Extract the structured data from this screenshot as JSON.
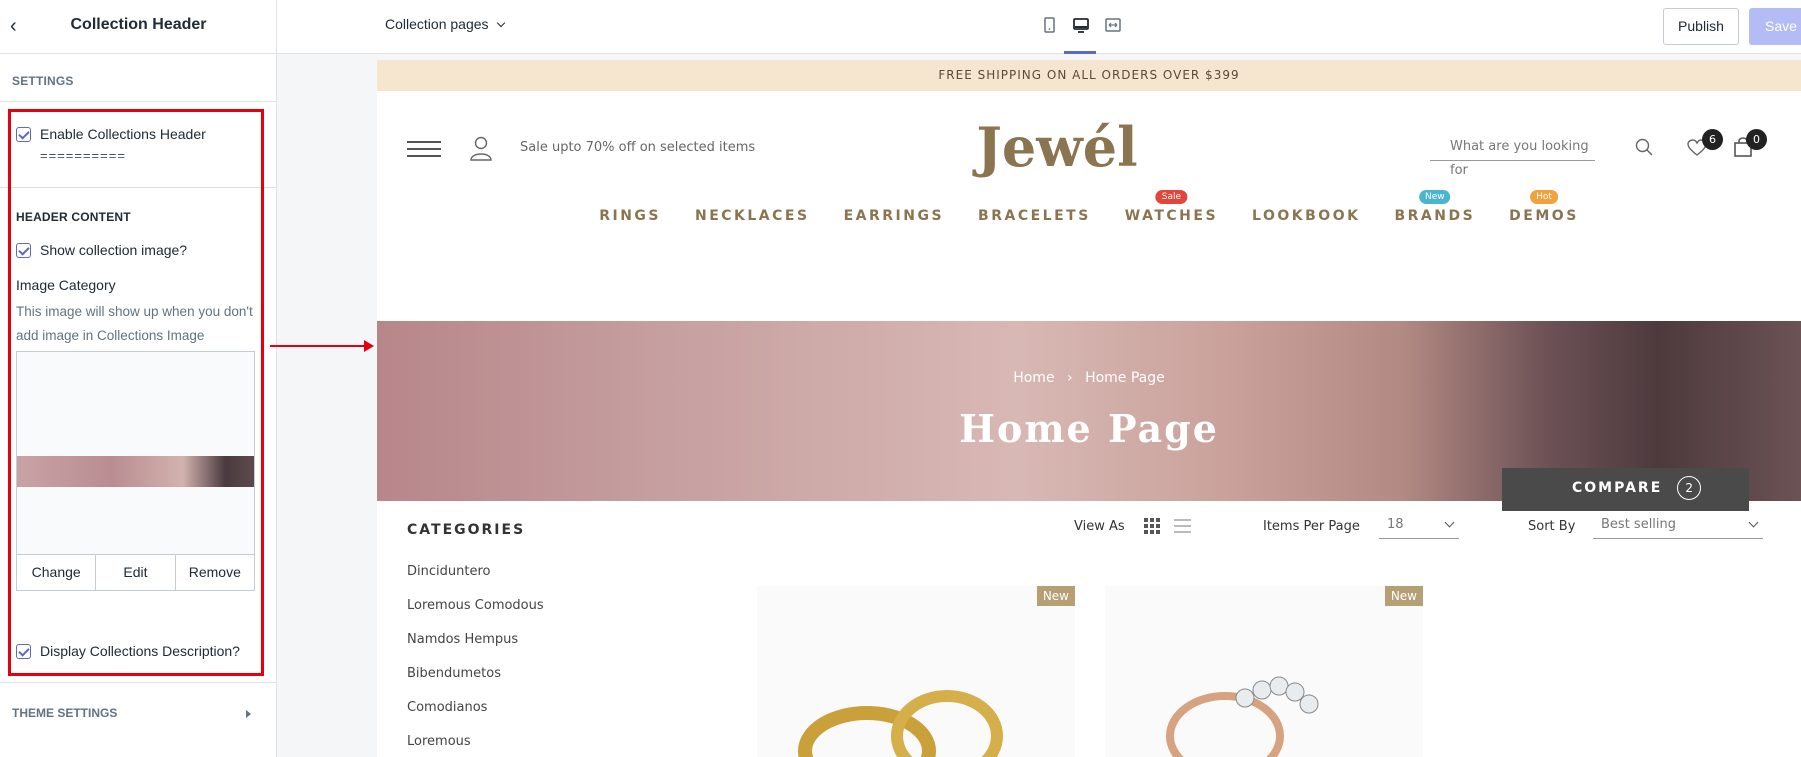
{
  "sidebar": {
    "title": "Collection Header",
    "settings_label": "SETTINGS",
    "enable_header_label": "Enable Collections Header",
    "divider_text": "==========",
    "header_content_label": "HEADER CONTENT",
    "show_image_label": "Show collection image?",
    "image_category_label": "Image Category",
    "image_help_text": "This image will show up when you don't add image in Collections Image",
    "image_buttons": [
      "Change",
      "Edit",
      "Remove"
    ],
    "display_desc_label": "Display Collections Description?",
    "theme_settings_label": "THEME SETTINGS"
  },
  "topbar": {
    "page_selector": "Collection pages",
    "publish_label": "Publish",
    "save_label": "Save"
  },
  "store": {
    "shipping_banner": "FREE SHIPPING ON ALL ORDERS OVER $399",
    "promo_text": "Sale upto 70% off on selected items",
    "logo": "Jewél",
    "search_placeholder": "What are you looking for",
    "wishlist_count": "6",
    "cart_count": "0",
    "nav": [
      {
        "label": "RINGS",
        "tag": "",
        "tag_color": ""
      },
      {
        "label": "NECKLACES",
        "tag": "",
        "tag_color": ""
      },
      {
        "label": "EARRINGS",
        "tag": "",
        "tag_color": ""
      },
      {
        "label": "BRACELETS",
        "tag": "",
        "tag_color": ""
      },
      {
        "label": "WATCHES",
        "tag": "Sale",
        "tag_color": "#e2463a"
      },
      {
        "label": "LOOKBOOK",
        "tag": "",
        "tag_color": ""
      },
      {
        "label": "BRANDS",
        "tag": "New",
        "tag_color": "#4bb5d1"
      },
      {
        "label": "DEMOS",
        "tag": "Hot",
        "tag_color": "#f2a23a"
      }
    ],
    "breadcrumb_home": "Home",
    "breadcrumb_sep": "›",
    "breadcrumb_current": "Home Page",
    "banner_title": "Home Page",
    "compare_label": "COMPARE",
    "compare_count": "2",
    "categories_title": "CATEGORIES",
    "categories": [
      "Dinciduntero",
      "Loremous Comodous",
      "Namdos Hempus",
      "Bibendumetos",
      "Comodianos",
      "Loremous"
    ],
    "view_as_label": "View As",
    "items_per_page_label": "Items Per Page",
    "items_per_page_value": "18",
    "sort_by_label": "Sort By",
    "sort_by_value": "Best selling",
    "product_tag": "New"
  }
}
